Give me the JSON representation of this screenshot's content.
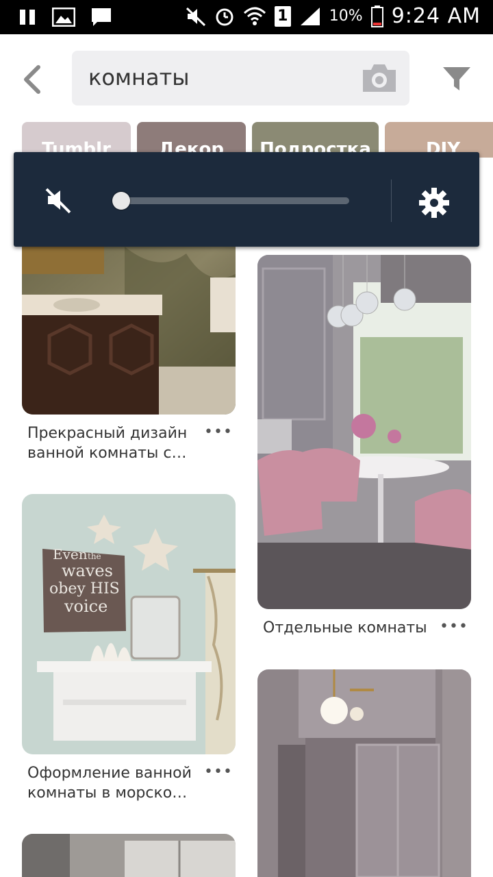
{
  "status_bar": {
    "battery_pct": "10%",
    "time": "9:24 AM",
    "sim_slot": "1",
    "icons": [
      "pause-icon",
      "image-icon",
      "message-icon",
      "mute-icon",
      "alarm-icon",
      "wifi-icon",
      "sim-icon",
      "signal-icon",
      "battery-icon"
    ]
  },
  "search": {
    "query": "комнаты",
    "icons": [
      "back-arrow-icon",
      "camera-icon",
      "filter-icon"
    ]
  },
  "chips": [
    {
      "label": "Tumblr",
      "color": "#d6cbce"
    },
    {
      "label": "Декор",
      "color": "#8e7c7a"
    },
    {
      "label": "Подростка",
      "color": "#8b8a74"
    },
    {
      "label": "DIY",
      "color": "#c7ab99"
    }
  ],
  "volume_panel": {
    "level": 0.0,
    "icons": [
      "volume-muted-icon",
      "settings-gear-icon"
    ]
  },
  "pins": [
    {
      "caption": "Прекрасный дизайн ванной комнаты с…",
      "more": "•••"
    },
    {
      "caption": "Отдельные комнаты",
      "more": "•••"
    },
    {
      "caption": "Оформление ванной комнаты в морско…",
      "more": "•••"
    },
    {
      "sign_text": "Even the waves obey HIS voice"
    }
  ],
  "colors": {
    "volume_bg": "#1c2a3c",
    "search_bg": "#efeff1"
  }
}
